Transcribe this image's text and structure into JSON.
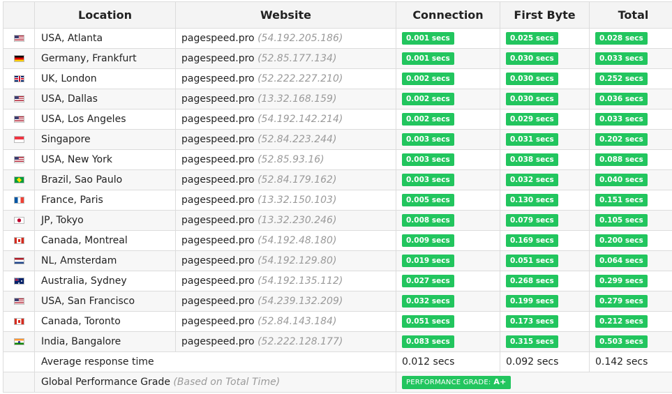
{
  "headers": {
    "location": "Location",
    "website": "Website",
    "connection": "Connection",
    "first_byte": "First Byte",
    "total": "Total"
  },
  "rows": [
    {
      "flag": "us-flag-icon",
      "location": "USA, Atlanta",
      "site": "pagespeed.pro",
      "ip": "(54.192.205.186)",
      "connection": "0.001 secs",
      "first_byte": "0.025 secs",
      "total": "0.028 secs"
    },
    {
      "flag": "de-flag-icon",
      "location": "Germany, Frankfurt",
      "site": "pagespeed.pro",
      "ip": "(52.85.177.134)",
      "connection": "0.001 secs",
      "first_byte": "0.030 secs",
      "total": "0.033 secs"
    },
    {
      "flag": "gb-flag-icon",
      "location": "UK, London",
      "site": "pagespeed.pro",
      "ip": "(52.222.227.210)",
      "connection": "0.002 secs",
      "first_byte": "0.030 secs",
      "total": "0.252 secs"
    },
    {
      "flag": "us-flag-icon",
      "location": "USA, Dallas",
      "site": "pagespeed.pro",
      "ip": "(13.32.168.159)",
      "connection": "0.002 secs",
      "first_byte": "0.030 secs",
      "total": "0.036 secs"
    },
    {
      "flag": "us-flag-icon",
      "location": "USA, Los Angeles",
      "site": "pagespeed.pro",
      "ip": "(54.192.142.214)",
      "connection": "0.002 secs",
      "first_byte": "0.029 secs",
      "total": "0.033 secs"
    },
    {
      "flag": "sg-flag-icon",
      "location": "Singapore",
      "site": "pagespeed.pro",
      "ip": "(52.84.223.244)",
      "connection": "0.003 secs",
      "first_byte": "0.031 secs",
      "total": "0.202 secs"
    },
    {
      "flag": "us-flag-icon",
      "location": "USA, New York",
      "site": "pagespeed.pro",
      "ip": "(52.85.93.16)",
      "connection": "0.003 secs",
      "first_byte": "0.038 secs",
      "total": "0.088 secs"
    },
    {
      "flag": "br-flag-icon",
      "location": "Brazil, Sao Paulo",
      "site": "pagespeed.pro",
      "ip": "(52.84.179.162)",
      "connection": "0.003 secs",
      "first_byte": "0.032 secs",
      "total": "0.040 secs"
    },
    {
      "flag": "fr-flag-icon",
      "location": "France, Paris",
      "site": "pagespeed.pro",
      "ip": "(13.32.150.103)",
      "connection": "0.005 secs",
      "first_byte": "0.130 secs",
      "total": "0.151 secs"
    },
    {
      "flag": "jp-flag-icon",
      "location": "JP, Tokyo",
      "site": "pagespeed.pro",
      "ip": "(13.32.230.246)",
      "connection": "0.008 secs",
      "first_byte": "0.079 secs",
      "total": "0.105 secs"
    },
    {
      "flag": "ca-flag-icon",
      "location": "Canada, Montreal",
      "site": "pagespeed.pro",
      "ip": "(54.192.48.180)",
      "connection": "0.009 secs",
      "first_byte": "0.169 secs",
      "total": "0.200 secs"
    },
    {
      "flag": "nl-flag-icon",
      "location": "NL, Amsterdam",
      "site": "pagespeed.pro",
      "ip": "(54.192.129.80)",
      "connection": "0.019 secs",
      "first_byte": "0.051 secs",
      "total": "0.064 secs"
    },
    {
      "flag": "au-flag-icon",
      "location": "Australia, Sydney",
      "site": "pagespeed.pro",
      "ip": "(54.192.135.112)",
      "connection": "0.027 secs",
      "first_byte": "0.268 secs",
      "total": "0.299 secs"
    },
    {
      "flag": "us-flag-icon",
      "location": "USA, San Francisco",
      "site": "pagespeed.pro",
      "ip": "(54.239.132.209)",
      "connection": "0.032 secs",
      "first_byte": "0.199 secs",
      "total": "0.279 secs"
    },
    {
      "flag": "ca-flag-icon",
      "location": "Canada, Toronto",
      "site": "pagespeed.pro",
      "ip": "(52.84.143.184)",
      "connection": "0.051 secs",
      "first_byte": "0.173 secs",
      "total": "0.212 secs"
    },
    {
      "flag": "in-flag-icon",
      "location": "India, Bangalore",
      "site": "pagespeed.pro",
      "ip": "(52.222.128.177)",
      "connection": "0.083 secs",
      "first_byte": "0.315 secs",
      "total": "0.503 secs"
    }
  ],
  "average": {
    "label": "Average response time",
    "connection": "0.012 secs",
    "first_byte": "0.092 secs",
    "total": "0.142 secs"
  },
  "grade": {
    "label": "Global Performance Grade",
    "sub": "(Based on Total Time)",
    "badge_label": "PERFORMANCE GRADE:",
    "badge_value": "A+"
  },
  "colors": {
    "badge_green": "#22c55e",
    "ip_gray": "#9a9a9a",
    "row_alt": "#f7f7f7"
  }
}
